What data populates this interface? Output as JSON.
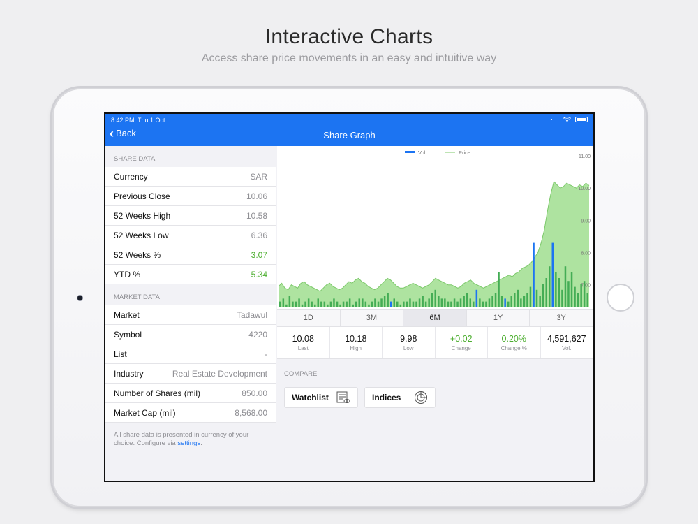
{
  "promo": {
    "title": "Interactive Charts",
    "subtitle": "Access share price movements in an easy and intuitive way"
  },
  "status_bar": {
    "time": "8:42 PM",
    "date": "Thu 1 Oct"
  },
  "nav": {
    "back_label": "Back",
    "title": "Share Graph"
  },
  "share_data": {
    "header": "SHARE DATA",
    "rows": [
      {
        "label": "Currency",
        "value": "SAR"
      },
      {
        "label": "Previous Close",
        "value": "10.06"
      },
      {
        "label": "52 Weeks High",
        "value": "10.58"
      },
      {
        "label": "52 Weeks Low",
        "value": "6.36"
      },
      {
        "label": "52 Weeks %",
        "value": "3.07"
      },
      {
        "label": "YTD %",
        "value": "5.34"
      }
    ]
  },
  "market_data": {
    "header": "MARKET DATA",
    "rows": [
      {
        "label": "Market",
        "value": "Tadawul"
      },
      {
        "label": "Symbol",
        "value": "4220"
      },
      {
        "label": "List",
        "value": "-"
      },
      {
        "label": "Industry",
        "value": "Real Estate Development"
      },
      {
        "label": "Number of Shares (mil)",
        "value": "850.00"
      },
      {
        "label": "Market Cap (mil)",
        "value": "8,568.00"
      }
    ]
  },
  "note": {
    "text": "All share data is presented in currency of your choice. Configure via ",
    "link": "settings",
    "suffix": "."
  },
  "tabs": [
    "1D",
    "3M",
    "6M",
    "1Y",
    "3Y"
  ],
  "active_tab": "6M",
  "stats": [
    {
      "value": "10.08",
      "label": "Last"
    },
    {
      "value": "10.18",
      "label": "High"
    },
    {
      "value": "9.98",
      "label": "Low"
    },
    {
      "value": "+0.02",
      "label": "Change"
    },
    {
      "value": "0.20%",
      "label": "Change %"
    },
    {
      "value": "4,591,627",
      "label": "Vol."
    }
  ],
  "compare": {
    "header": "COMPARE",
    "watchlist_label": "Watchlist",
    "indices_label": "Indices"
  },
  "colors": {
    "nav": "#1c74f2",
    "price_fill": "#aee3a0",
    "price_line": "#7cc96a",
    "volume_bar": "#44ad55",
    "volume_spike": "#1c74f2",
    "positive": "#4cae2f"
  },
  "chart_data": {
    "type": "area",
    "legend": [
      "Vol.",
      "Price"
    ],
    "legend_position": "top-center",
    "y_ticks": [
      "11.00",
      "10.00",
      "9.00",
      "8.00",
      "7.00"
    ],
    "ylim": [
      6.3,
      11.0
    ],
    "price": [
      6.95,
      7.05,
      6.9,
      6.85,
      7.0,
      6.95,
      6.9,
      7.05,
      7.1,
      7.0,
      6.95,
      6.9,
      6.85,
      6.8,
      6.9,
      7.0,
      7.05,
      6.95,
      6.9,
      6.85,
      6.9,
      7.0,
      7.1,
      7.05,
      7.15,
      7.2,
      7.1,
      7.05,
      6.95,
      6.9,
      6.85,
      6.9,
      7.0,
      7.1,
      7.2,
      7.15,
      7.05,
      6.95,
      6.9,
      6.9,
      6.95,
      7.0,
      7.05,
      7.0,
      6.95,
      6.9,
      6.95,
      7.0,
      7.1,
      7.2,
      7.15,
      7.1,
      7.05,
      7.0,
      7.0,
      6.95,
      6.9,
      6.95,
      7.05,
      7.1,
      7.15,
      7.05,
      7.0,
      6.95,
      6.9,
      6.95,
      7.0,
      7.05,
      7.1,
      7.15,
      7.2,
      7.25,
      7.3,
      7.25,
      7.35,
      7.4,
      7.5,
      7.55,
      7.6,
      7.7,
      7.85,
      8.0,
      8.3,
      8.7,
      9.3,
      9.8,
      10.2,
      10.1,
      10.0,
      10.05,
      10.15,
      10.1,
      10.05,
      10.0,
      10.1,
      10.05,
      10.15,
      10.08
    ],
    "volume": [
      2,
      3,
      1,
      4,
      2,
      2,
      3,
      1,
      2,
      3,
      2,
      1,
      3,
      2,
      2,
      1,
      2,
      3,
      2,
      1,
      2,
      2,
      3,
      1,
      2,
      3,
      3,
      2,
      1,
      2,
      3,
      2,
      3,
      4,
      5,
      2,
      3,
      2,
      1,
      2,
      2,
      3,
      2,
      2,
      3,
      4,
      2,
      3,
      5,
      6,
      4,
      3,
      3,
      2,
      2,
      3,
      2,
      3,
      4,
      5,
      3,
      2,
      6,
      3,
      2,
      2,
      3,
      4,
      5,
      12,
      4,
      3,
      2,
      4,
      5,
      6,
      3,
      4,
      5,
      7,
      22,
      6,
      4,
      8,
      10,
      14,
      22,
      12,
      10,
      6,
      14,
      9,
      12,
      7,
      5,
      8,
      9,
      5
    ],
    "volume_spikes": [
      35,
      62,
      71,
      80,
      86
    ]
  }
}
